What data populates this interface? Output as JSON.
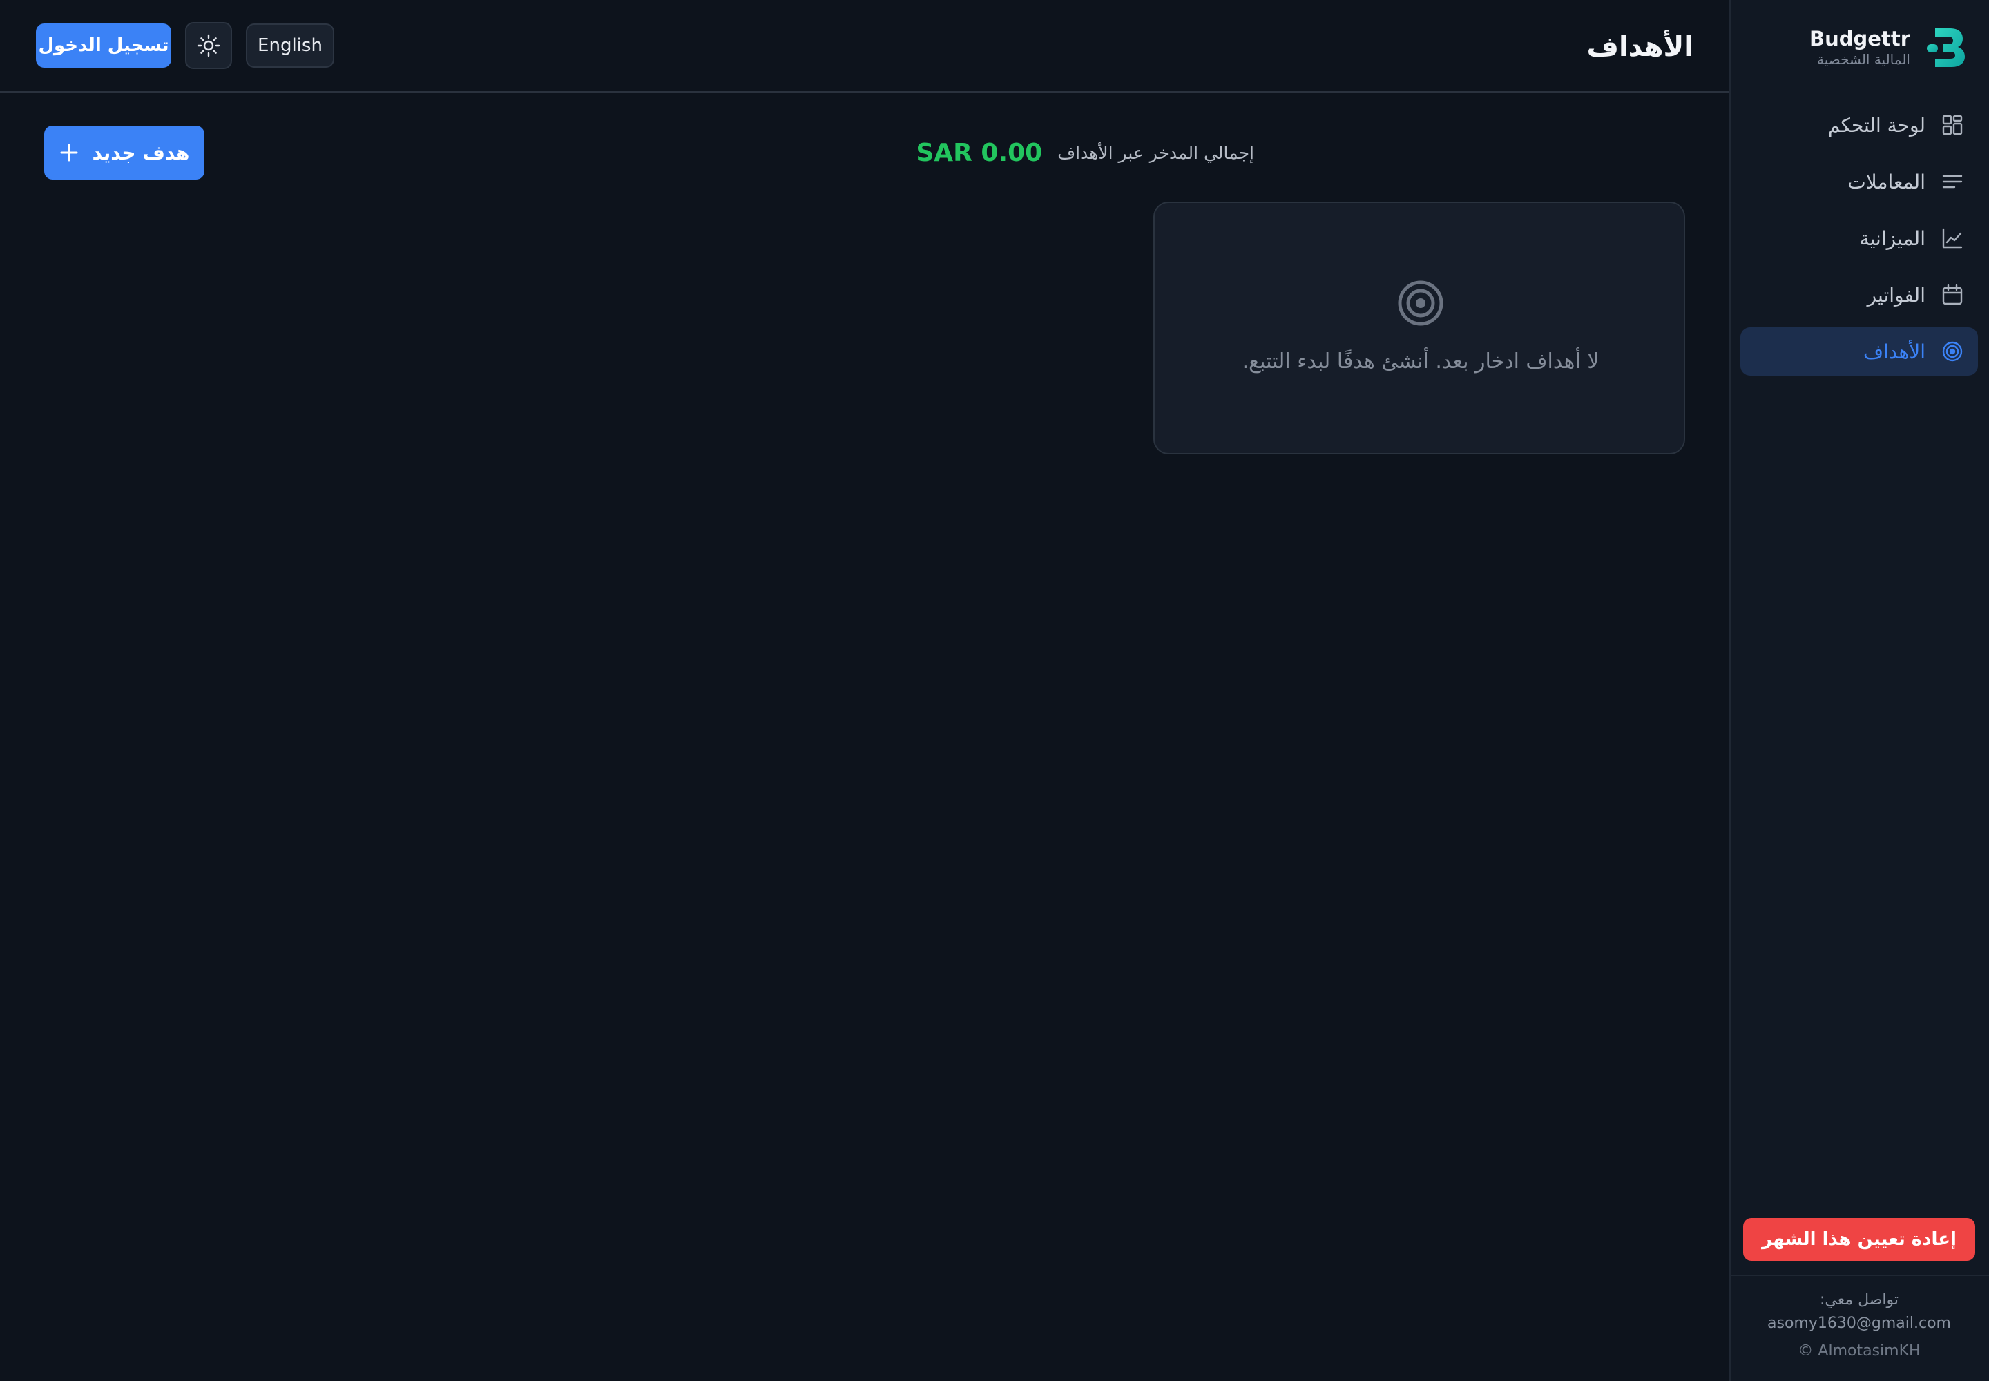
{
  "sidebar": {
    "brand_name": "Budgettr",
    "brand_sub": "المالية الشخصية",
    "items": [
      {
        "label": "لوحة التحكم",
        "icon": "dashboard-grid-icon"
      },
      {
        "label": "المعاملات",
        "icon": "list-lines-icon"
      },
      {
        "label": "الميزانية",
        "icon": "line-chart-icon"
      },
      {
        "label": "الفواتير",
        "icon": "calendar-icon"
      },
      {
        "label": "الأهداف",
        "icon": "target-icon",
        "active": true
      }
    ],
    "reset_label": "إعادة تعيين هذا الشهر",
    "contact_label": "تواصل معي:",
    "contact_email": "asomy1630@gmail.com",
    "copyright": "© AlmotasimKH"
  },
  "header": {
    "title": "الأهداف",
    "login_label": "تسجيل الدخول",
    "language_label": "English",
    "theme_icon": "sun-icon"
  },
  "main": {
    "new_goal_label": "هدف جديد",
    "total_label": "إجمالي المدخر عبر الأهداف",
    "total_value": "SAR 0.00",
    "empty_message": "لا أهداف ادخار بعد. أنشئ هدفًا لبدء التتبع."
  },
  "colors": {
    "accent": "#3b82f6",
    "success": "#22c55e",
    "danger": "#ef4444",
    "background": "#0d131c",
    "sidebar": "#111823"
  }
}
